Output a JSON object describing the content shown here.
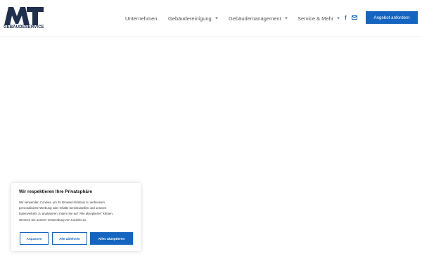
{
  "brand": {
    "logo_text": "MT",
    "logo_subtitle": "GEBÄUDESERVICE",
    "primary_color": "#1565c0",
    "logo_color": "#1f2f4d"
  },
  "nav": {
    "items": [
      {
        "label": "Unternehmen",
        "has_dropdown": false
      },
      {
        "label": "Gebäudereinigung",
        "has_dropdown": true
      },
      {
        "label": "Gebäudemanagement",
        "has_dropdown": true
      },
      {
        "label": "Service & Mehr",
        "has_dropdown": true
      }
    ],
    "social": {
      "facebook_icon": "f",
      "mail_icon": "mail-icon"
    },
    "cta_label": "Angebot anfordern"
  },
  "cookie_banner": {
    "title": "Wir respektieren Ihre Privatsphäre",
    "text_lines": [
      "Wir verwenden Cookies, um Ihr Browser-Erlebnis zu verbessern,",
      "personalisierte Werbung oder Inhalte bereitzustellen und unseren",
      "Datenverkehr zu analysieren. Indem Sie auf \"Alle akzeptieren\" klicken,",
      "stimmen Sie unserer Verwendung von Cookies zu."
    ],
    "buttons": {
      "customize": "Anpassen",
      "reject": "Alle ablehnen",
      "accept": "Alles akzeptieren"
    }
  }
}
